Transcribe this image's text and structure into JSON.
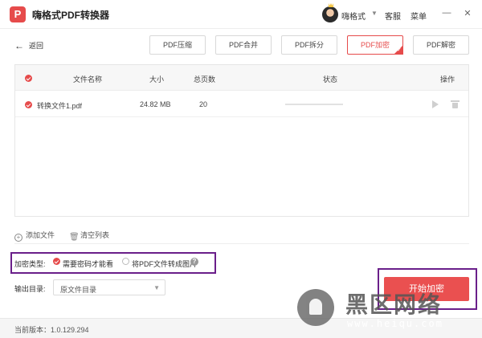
{
  "titlebar": {
    "app_title": "嗨格式PDF转换器",
    "logo_glyph": "P",
    "username": "嗨格式",
    "service": "客服",
    "menu": "菜单",
    "minimize": "—",
    "close": "✕"
  },
  "nav": {
    "back_label": "返回",
    "back_icon": "←"
  },
  "tabs": [
    {
      "label": "PDF压缩"
    },
    {
      "label": "PDF合并"
    },
    {
      "label": "PDF拆分"
    },
    {
      "label": "PDF加密"
    },
    {
      "label": "PDF解密"
    }
  ],
  "table": {
    "headers": {
      "name": "文件名称",
      "size": "大小",
      "pages": "总页数",
      "status": "状态",
      "action": "操作"
    },
    "rows": [
      {
        "name": "转换文件1.pdf",
        "size": "24.82 MB",
        "pages": "20",
        "progress": 0
      }
    ]
  },
  "actions": {
    "add_file": "添加文件",
    "clear_list": "清空列表"
  },
  "encryption": {
    "label": "加密类型:",
    "option1": "需要密码才能看",
    "option2": "将PDF文件转成图片",
    "help": "?"
  },
  "output": {
    "label": "输出目录:",
    "value": "原文件目录"
  },
  "start_button": "开始加密",
  "status": {
    "version": "当前版本：1.0.129.294"
  },
  "watermark": {
    "title": "黑区网络",
    "url": "www.heiqu.com"
  },
  "colors": {
    "accent": "#e64b4b",
    "highlight": "#6a1f8a"
  }
}
